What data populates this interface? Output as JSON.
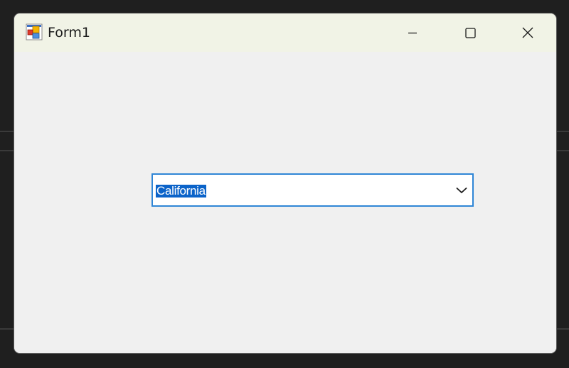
{
  "window": {
    "title": "Form1",
    "icon": "winforms-app-icon",
    "controls": {
      "minimize_icon": "minimize-icon",
      "maximize_icon": "maximize-icon",
      "close_icon": "close-icon"
    }
  },
  "combobox": {
    "selected_value": "California",
    "dropdown_icon": "chevron-down-icon",
    "focused": true,
    "text_selected": true
  },
  "colors": {
    "titlebar": "#f1f3e6",
    "client_area": "#f0f0f0",
    "focus_border": "#2f86d6",
    "selection_highlight": "#0b63c9"
  }
}
